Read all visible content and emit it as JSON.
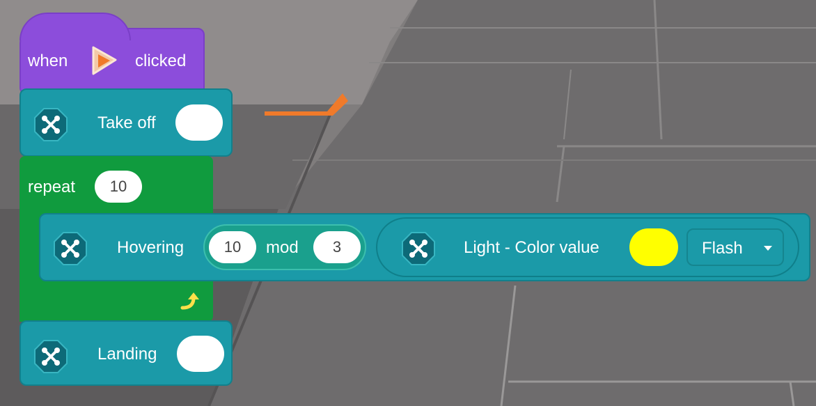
{
  "hat_block": {
    "when_label": "when",
    "clicked_label": "clicked",
    "icon": "play-flag-icon"
  },
  "takeoff_block": {
    "label": "Take off",
    "icon": "drone-icon"
  },
  "repeat_block": {
    "label": "repeat",
    "count": "10",
    "icon_end": "repeat-arrow-icon"
  },
  "hover_block": {
    "label": "Hovering",
    "mod_block": {
      "left": "10",
      "op": "mod",
      "right": "3"
    },
    "light_block": {
      "label": "Light - Color value",
      "color": "#ffff00",
      "mode": "Flash",
      "icon": "drone-icon"
    }
  },
  "landing_block": {
    "label": "Landing",
    "icon": "drone-icon"
  },
  "colors": {
    "teal": "#1b9aa8",
    "purple": "#8c4ddb",
    "green": "#109b3e",
    "accent_orange": "#f07a2a"
  }
}
